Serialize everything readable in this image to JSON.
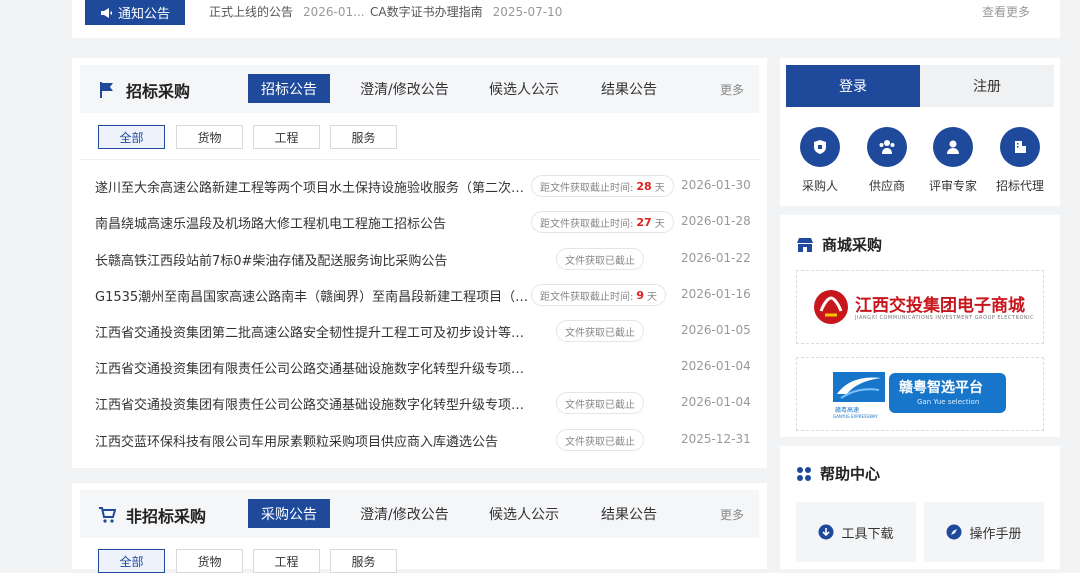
{
  "notice": {
    "tag": "通知公告",
    "items": [
      {
        "title": "正式上线的公告",
        "date": "2026-01..."
      },
      {
        "title": "CA数字证书办理指南",
        "date": "2025-07-10"
      }
    ],
    "more": "查看更多"
  },
  "bid": {
    "title": "招标采购",
    "tabs": [
      "招标公告",
      "澄清/修改公告",
      "候选人公示",
      "结果公告"
    ],
    "more": "更多",
    "filters": [
      "全部",
      "货物",
      "工程",
      "服务"
    ],
    "rows": [
      {
        "title": "遂川至大余高速公路新建工程等两个项目水土保持设施验收服务（第二次…",
        "badge_prefix": "距文件获取截止时间:",
        "days": "28",
        "unit": "天",
        "date": "2026-01-30"
      },
      {
        "title": "南昌绕城高速乐温段及机场路大修工程机电工程施工招标公告",
        "badge_prefix": "距文件获取截止时间:",
        "days": "27",
        "unit": "天",
        "date": "2026-01-28"
      },
      {
        "title": "长赣高铁江西段站前7标0#柴油存储及配送服务询比采购公告",
        "badge_text": "文件获取已截止",
        "date": "2026-01-22"
      },
      {
        "title": "G1535潮州至南昌国家高速公路南丰（赣闽界）至南昌段新建工程项目（…",
        "badge_prefix": "距文件获取截止时间:",
        "days": "9",
        "unit": "天",
        "date": "2026-01-16"
      },
      {
        "title": "江西省交通投资集团第二批高速公路安全韧性提升工程工可及初步设计等…",
        "badge_text": "文件获取已截止",
        "date": "2026-01-05"
      },
      {
        "title": "江西省交通投资集团有限责任公司公路交通基础设施数字化转型升级专项…",
        "date": "2026-01-04"
      },
      {
        "title": "江西省交通投资集团有限责任公司公路交通基础设施数字化转型升级专项…",
        "badge_text": "文件获取已截止",
        "date": "2026-01-04"
      },
      {
        "title": "江西交蓝环保科技有限公司车用尿素颗粒采购项目供应商入库遴选公告",
        "badge_text": "文件获取已截止",
        "date": "2025-12-31"
      }
    ]
  },
  "nonbid": {
    "title": "非招标采购",
    "tabs": [
      "采购公告",
      "澄清/修改公告",
      "候选人公示",
      "结果公告"
    ],
    "more": "更多",
    "filters": [
      "全部",
      "货物",
      "工程",
      "服务"
    ]
  },
  "auth": {
    "login": "登录",
    "register": "注册",
    "roles": [
      "采购人",
      "供应商",
      "评审专家",
      "招标代理"
    ]
  },
  "mall": {
    "title": "商城采购",
    "banner1_cn": "江西交投集团电子商城",
    "banner1_en": "JIANGXI COMMUNICATIONS INVESTMENT GROUP ELECTRONIC MALL",
    "banner2_logo_cn": "赣粤高速",
    "banner2_logo_en": "GANYUE EXPRESSWAY",
    "banner2_cn": "赣粤智选平台",
    "banner2_en": "Gan Yue selection"
  },
  "help": {
    "title": "帮助中心",
    "download": "工具下载",
    "manual": "操作手册"
  },
  "colors": {
    "primary": "#1f4a9c",
    "deadline_red": "#e02020",
    "mall_red": "#c8161d"
  }
}
